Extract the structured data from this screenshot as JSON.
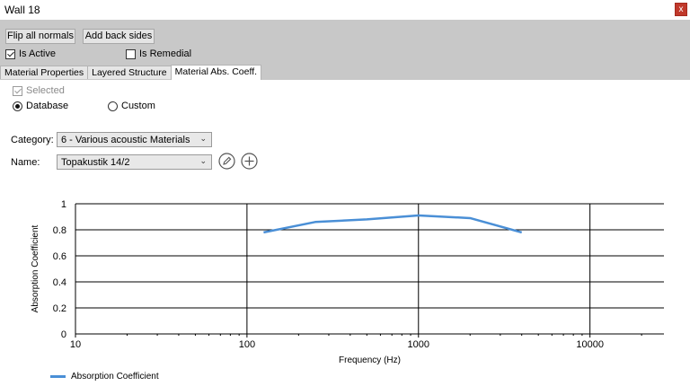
{
  "window": {
    "title": "Wall 18",
    "close_label": "x"
  },
  "toolbar": {
    "flip_label": "Flip all normals",
    "add_back_label": "Add back sides",
    "is_active_label": "Is Active",
    "is_remedial_label": "Is Remedial",
    "is_active": true,
    "is_remedial": false
  },
  "tabs": [
    {
      "label": "Material Properties"
    },
    {
      "label": "Layered Structure"
    },
    {
      "label": "Material Abs. Coeff."
    }
  ],
  "form": {
    "selected_label": "Selected",
    "database_label": "Database",
    "custom_label": "Custom",
    "category_label": "Category:",
    "category_value": "6 - Various acoustic Materials",
    "name_label": "Name:",
    "name_value": "Topakustik 14/2"
  },
  "chart_data": {
    "type": "line",
    "x_scale": "log",
    "xlabel": "Frequency (Hz)",
    "ylabel": "Absorption Coefficient",
    "xlim": [
      10,
      27000
    ],
    "ylim": [
      0,
      1
    ],
    "x_ticks": [
      "10",
      "100",
      "1000",
      "10000"
    ],
    "y_ticks": [
      "0",
      "0.2",
      "0.4",
      "0.6",
      "0.8",
      "1"
    ],
    "grid": true,
    "legend_position": "bottom-left",
    "series": [
      {
        "name": "Absorption Coefficient",
        "color": "#4a8fd6",
        "x": [
          125,
          250,
          500,
          1000,
          2000,
          4000
        ],
        "y": [
          0.78,
          0.86,
          0.88,
          0.91,
          0.89,
          0.78
        ]
      }
    ]
  }
}
